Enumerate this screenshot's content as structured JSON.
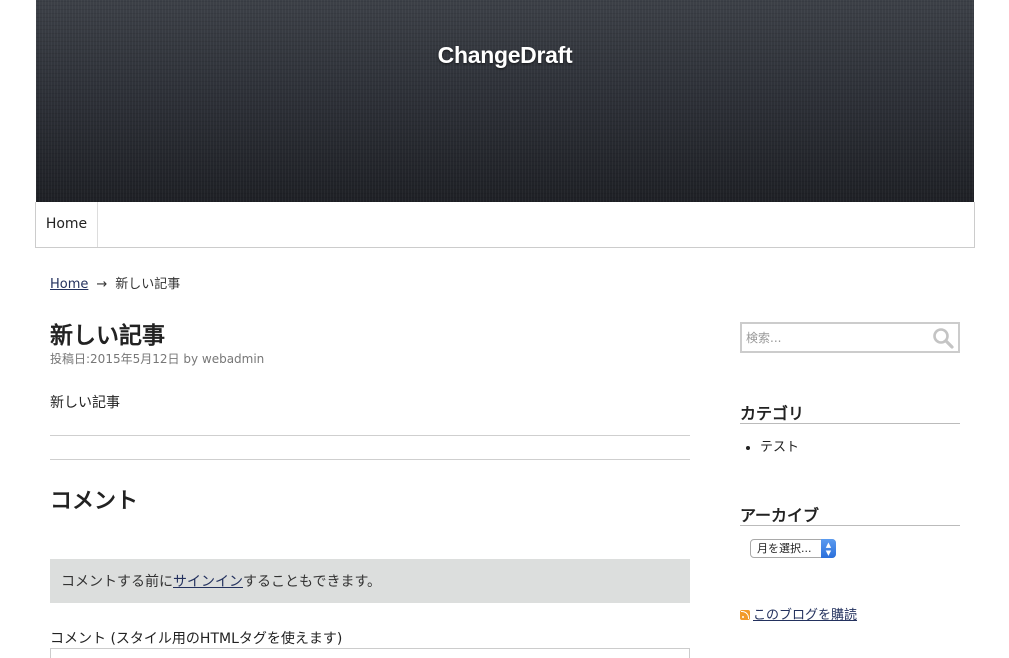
{
  "site": {
    "title": "ChangeDraft"
  },
  "nav": {
    "items": [
      {
        "label": "Home"
      }
    ]
  },
  "breadcrumb": {
    "home": "Home",
    "separator": "→",
    "current": "新しい記事"
  },
  "post": {
    "title": "新しい記事",
    "meta_prefix": "投稿日:",
    "date": "2015年5月12日",
    "by": "by",
    "author": "webadmin",
    "body": "新しい記事"
  },
  "comments": {
    "title": "コメント",
    "login_before": "コメントする前に",
    "login_link": "サインイン",
    "login_after": "することもできます。",
    "field_label": "コメント (スタイル用のHTMLタグを使えます)"
  },
  "sidebar": {
    "search": {
      "placeholder": "検索..."
    },
    "categories": {
      "title": "カテゴリ",
      "items": [
        "テスト"
      ]
    },
    "archives": {
      "title": "アーカイブ",
      "select_value": "月を選択..."
    },
    "subscribe": {
      "label": "このブログを購読"
    }
  },
  "colors": {
    "header_bg": "#2e3138",
    "link": "#23315e",
    "login_box_bg": "#dcdedd",
    "select_accent": "#2a6fdb",
    "rss": "#f29a2b"
  }
}
